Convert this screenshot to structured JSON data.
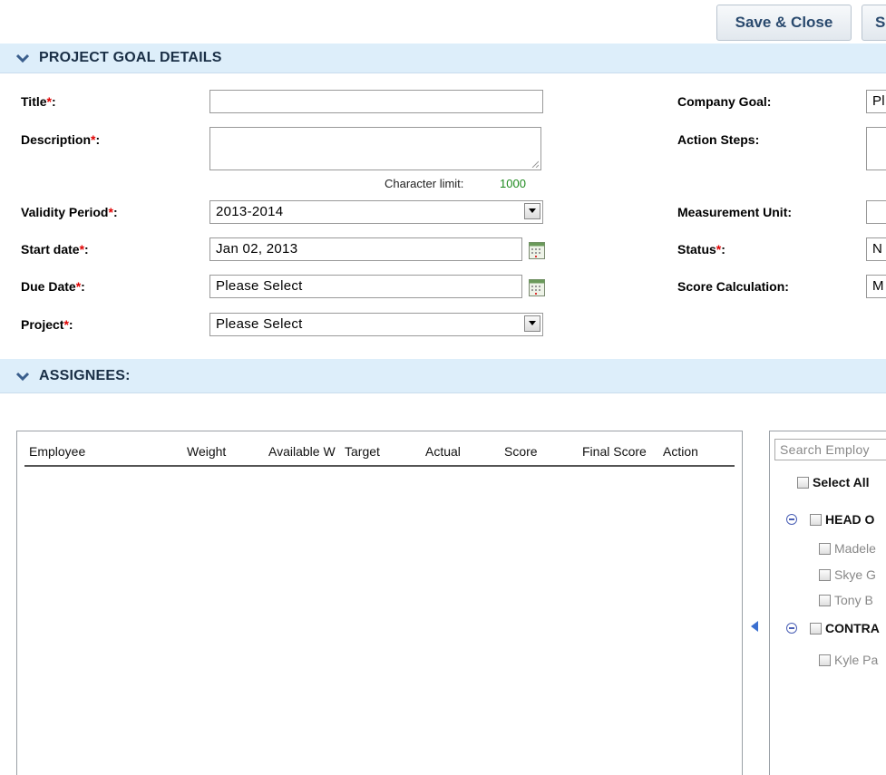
{
  "toolbar": {
    "save_close_label": "Save & Close",
    "save_partial_label": "S"
  },
  "sections": {
    "details_title": "PROJECT GOAL DETAILS",
    "assignees_title": "ASSIGNEES:"
  },
  "form": {
    "title_label": "Title",
    "description_label": "Description",
    "char_limit_label": "Character limit:",
    "char_limit_value": "1000",
    "validity_label": "Validity Period",
    "validity_value": "2013-2014",
    "start_label": "Start date",
    "start_value": "Jan 02, 2013",
    "due_label": "Due Date",
    "due_value": "Please Select",
    "project_label": "Project",
    "project_value": "Please Select",
    "required_mark": "*",
    "colon": ":",
    "company_goal_label": "Company Goal:",
    "company_goal_value": "Pl",
    "action_steps_label": "Action Steps:",
    "measurement_label": "Measurement Unit:",
    "status_label": "Status",
    "status_value": "N",
    "score_calc_label": "Score Calculation:",
    "score_calc_value": "M"
  },
  "table": {
    "columns": [
      "Employee",
      "Weight",
      "Available W",
      "Target",
      "Actual",
      "Score",
      "Final Score",
      "Action"
    ]
  },
  "picker": {
    "search_placeholder": "Search Employ",
    "select_all_label": "Select All",
    "groups": [
      {
        "name": "HEAD O",
        "employees": [
          "Madele",
          "Skye G",
          "Tony B"
        ]
      },
      {
        "name": "CONTRA",
        "employees": [
          "Kyle Pa"
        ]
      }
    ]
  },
  "colors": {
    "section_bg": "#ddeefa",
    "required": "#e00000",
    "limit_value": "#1e8a1e",
    "button_text": "#2a4a6e"
  },
  "icons": [
    "chevron-down-icon",
    "calendar-icon",
    "dropdown-arrow-icon",
    "collapse-minus-icon",
    "move-left-arrow-icon"
  ]
}
